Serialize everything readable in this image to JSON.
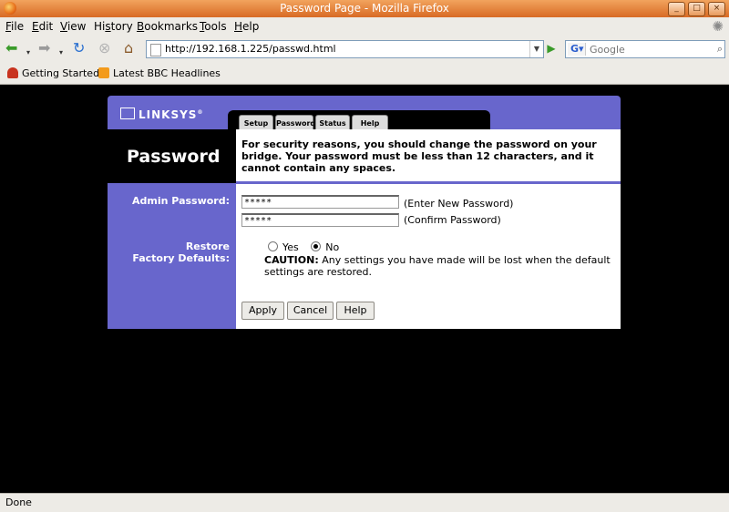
{
  "window": {
    "title": "Password Page - Mozilla Firefox",
    "controls": [
      "_",
      "□",
      "×"
    ]
  },
  "menu": [
    {
      "label": "File",
      "accel": "F",
      "rest": "ile"
    },
    {
      "label": "Edit",
      "accel": "E",
      "rest": "dit"
    },
    {
      "label": "View",
      "accel": "V",
      "rest": "iew"
    },
    {
      "label": "History",
      "accel": "s",
      "pre": "Hi",
      "rest": "tory"
    },
    {
      "label": "Bookmarks",
      "accel": "B",
      "rest": "ookmarks"
    },
    {
      "label": "Tools",
      "accel": "T",
      "rest": "ools"
    },
    {
      "label": "Help",
      "accel": "H",
      "rest": "elp"
    }
  ],
  "nav": {
    "url": "http://192.168.1.225/passwd.html",
    "search_placeholder": "Google",
    "icons": [
      "back-icon",
      "forward-icon",
      "reload-icon",
      "stop-icon",
      "home-icon"
    ]
  },
  "bookmarks": [
    "Getting Started",
    "Latest BBC Headlines"
  ],
  "page": {
    "logo": "LINKSYS",
    "tabs": [
      "Setup",
      "Password",
      "Status",
      "Help"
    ],
    "title": "Password",
    "info": "For security reasons, you should change the password on your bridge. Your password must be less than 12 characters, and it cannot contain any spaces.",
    "admin_label": "Admin Password:",
    "password_value": "*****",
    "confirm_value": "*****",
    "enter_hint": "(Enter New Password)",
    "confirm_hint": "(Confirm Password)",
    "restore_label_1": "Restore",
    "restore_label_2": "Factory Defaults:",
    "radio_yes": "Yes",
    "radio_no": "No",
    "radio_selected": "No",
    "caution_label": "CAUTION:",
    "caution_text": " Any settings you have made will be lost when the default settings are restored.",
    "buttons": {
      "apply": "Apply",
      "cancel": "Cancel",
      "help": "Help"
    }
  },
  "status": "Done",
  "colors": {
    "linksys_purple": "#6866cc",
    "titlebar_orange": "#e07a30",
    "chrome_bg": "#edebe6"
  }
}
